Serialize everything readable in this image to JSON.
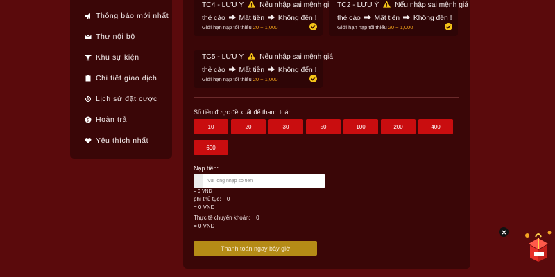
{
  "sidebar": {
    "items": [
      {
        "label": "Thông báo mới nhất",
        "icon": "megaphone-icon"
      },
      {
        "label": "Thư nội bộ",
        "icon": "envelope-icon"
      },
      {
        "label": "Khu sự kiện",
        "icon": "trophy-icon"
      },
      {
        "label": "Chi tiết giao dịch",
        "icon": "clipboard-icon"
      },
      {
        "label": "Lịch sử đặt cược",
        "icon": "history-icon"
      },
      {
        "label": "Hoàn trả",
        "icon": "refund-icon"
      },
      {
        "label": "Yêu thích nhất",
        "icon": "heart-icon"
      }
    ]
  },
  "channels": [
    {
      "name": "TC4",
      "warn_prefix": "- LƯU Ý",
      "warn_text": "Nếu nhập sai mệnh giá",
      "line2a": "thẻ cào",
      "line2b": "Mất tiền",
      "line2c": "Không đến !",
      "limit_label": "Giới hạn nạp tối thiểu",
      "limit_range": "20 ~ 1,000"
    },
    {
      "name": "TC2",
      "warn_prefix": "- LƯU Ý",
      "warn_text": "Nếu nhập sai mệnh giá",
      "line2a": "thẻ cào",
      "line2b": "Mất tiền",
      "line2c": "Không đến !",
      "limit_label": "Giới hạn nạp tối thiểu",
      "limit_range": "20 ~ 1,000"
    },
    {
      "name": "TC5",
      "warn_prefix": "- LƯU Ý",
      "warn_text": "Nếu nhập sai mệnh giá",
      "line2a": "thẻ cào",
      "line2b": "Mất tiền",
      "line2c": "Không đến !",
      "limit_label": "Giới hạn nạp tối thiểu",
      "limit_range": "20 ~ 1,000"
    }
  ],
  "suggested": {
    "label": "Số tiền được đề xuất để thanh toán:",
    "amounts": [
      "10",
      "20",
      "30",
      "50",
      "100",
      "200",
      "400",
      "600"
    ]
  },
  "deposit": {
    "label": "Nạp tiền:",
    "placeholder": "Vui lòng nhập số tiền",
    "converted": "= 0 VND",
    "fee_label": "phí thủ tục:",
    "fee_value": "0",
    "fee_converted": "= 0 VND",
    "actual_label": "Thực tế chuyển khoản:",
    "actual_value": "0",
    "actual_converted": "= 0 VND",
    "submit_label": "Thanh toán ngay bây giờ"
  },
  "colors": {
    "page_bg": "#5a0a0c",
    "panel_bg": "#3a0607",
    "amount_button": "#c90d0f",
    "submit_button": "#b58b16",
    "highlight": "#f3a21a",
    "check": "#f5c518"
  }
}
